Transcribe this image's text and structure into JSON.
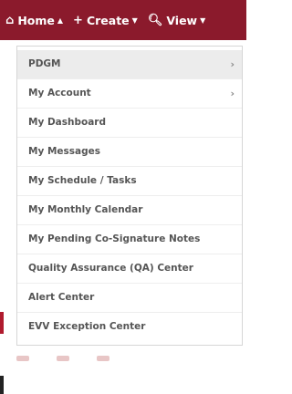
{
  "navbar": {
    "background": "#8b1a2c",
    "items": [
      {
        "label": "Home",
        "icon": "home-icon",
        "glyph": "⌂",
        "caret": "▲"
      },
      {
        "label": "Create",
        "icon": "plus-icon",
        "glyph": "+",
        "caret": "▼"
      },
      {
        "label": "View",
        "icon": "search-icon",
        "glyph": "🔍︎",
        "caret": "▼"
      }
    ]
  },
  "menu": {
    "items": [
      {
        "label": "PDGM",
        "has_submenu": true
      },
      {
        "label": "My Account",
        "has_submenu": true
      },
      {
        "label": "My Dashboard",
        "has_submenu": false
      },
      {
        "label": "My Messages",
        "has_submenu": false
      },
      {
        "label": "My Schedule / Tasks",
        "has_submenu": false
      },
      {
        "label": "My Monthly Calendar",
        "has_submenu": false
      },
      {
        "label": "My Pending Co-Signature Notes",
        "has_submenu": false
      },
      {
        "label": "Quality Assurance (QA) Center",
        "has_submenu": false
      },
      {
        "label": "Alert Center",
        "has_submenu": false
      },
      {
        "label": "EVV Exception Center",
        "has_submenu": false
      }
    ],
    "submenu_glyph": "›"
  }
}
